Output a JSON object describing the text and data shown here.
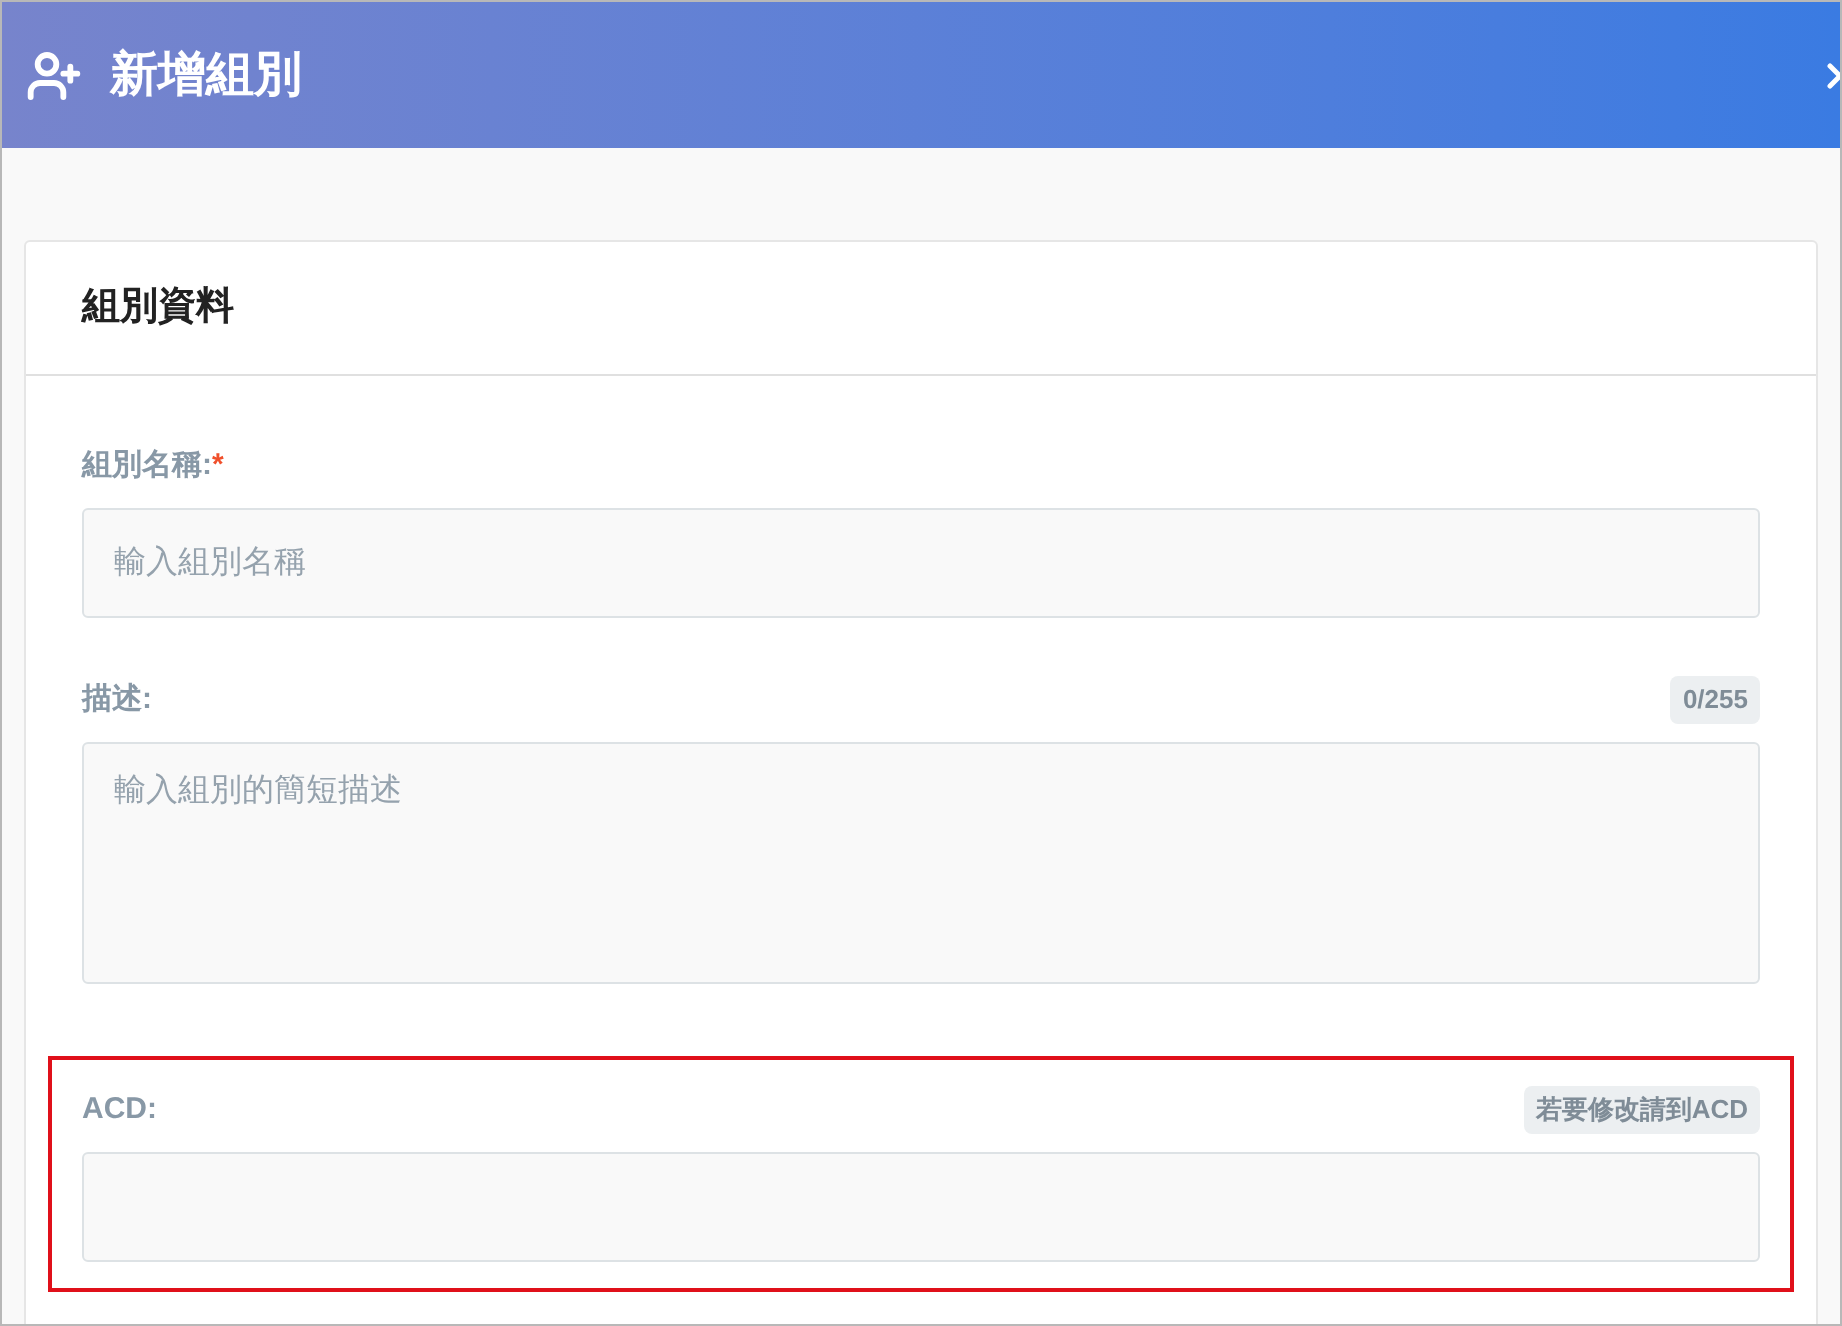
{
  "dialog": {
    "title": "新增組別"
  },
  "card": {
    "title": "組別資料"
  },
  "fields": [
    {
      "kind": "input",
      "label": "組別名稱:",
      "required_mark": "*",
      "placeholder": "輸入組別名稱",
      "highlighted": false
    },
    {
      "kind": "textarea",
      "label": "描述:",
      "placeholder": "輸入組別的簡短描述",
      "badge": "0/255",
      "highlighted": false
    },
    {
      "kind": "input",
      "label": "ACD:",
      "badge": "若要修改請到ACD",
      "highlighted": true
    }
  ]
}
